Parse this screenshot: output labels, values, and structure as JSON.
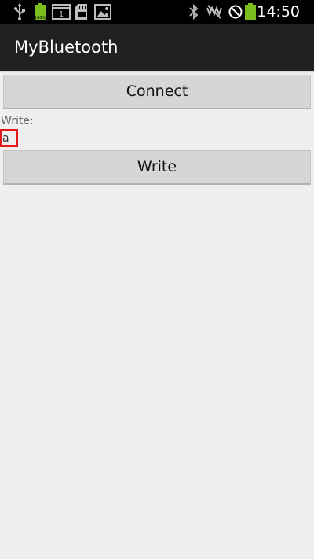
{
  "status_bar": {
    "time": "14:50",
    "battery_label": "100%",
    "notification_count": "1",
    "icons": [
      "usb-icon",
      "battery-notification-icon",
      "notification-count-icon",
      "sd-card-icon",
      "gallery-icon",
      "bluetooth-icon",
      "mute-icon",
      "no-signal-icon",
      "battery-icon"
    ],
    "battery_color": "#7cbd1e"
  },
  "action_bar": {
    "title": "MyBluetooth"
  },
  "main": {
    "connect_label": "Connect",
    "write_label": "Write:",
    "write_value": "a",
    "write_button_label": "Write"
  },
  "colors": {
    "background": "#efefef",
    "action_bar": "#212121",
    "status_bar": "#000000",
    "input_border": "#e41b1b",
    "button": "#d6d6d6"
  }
}
